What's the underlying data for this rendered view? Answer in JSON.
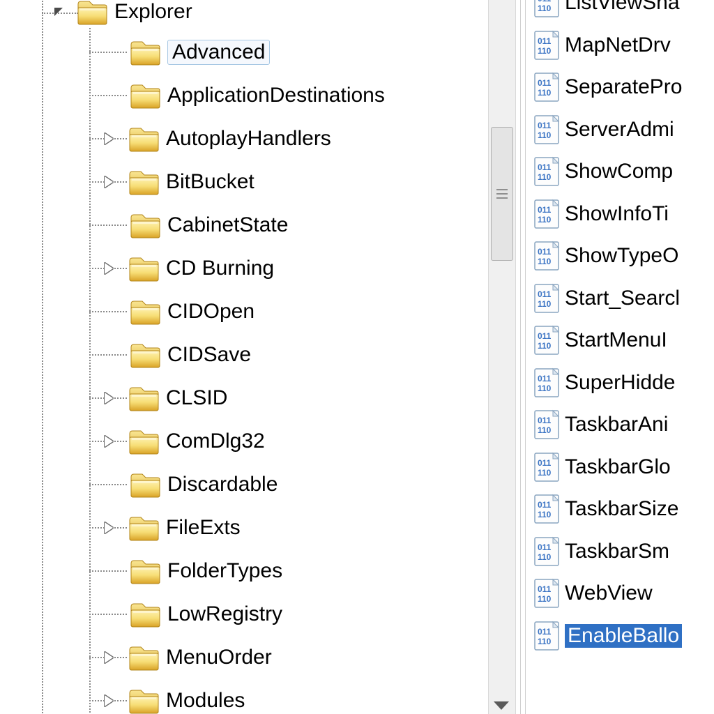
{
  "tree": {
    "root_label": "Explorer",
    "children": [
      {
        "label": "Advanced",
        "expander": "none",
        "selected": true
      },
      {
        "label": "ApplicationDestinations",
        "expander": "none"
      },
      {
        "label": "AutoplayHandlers",
        "expander": "closed"
      },
      {
        "label": "BitBucket",
        "expander": "closed"
      },
      {
        "label": "CabinetState",
        "expander": "none"
      },
      {
        "label": "CD Burning",
        "expander": "closed"
      },
      {
        "label": "CIDOpen",
        "expander": "none"
      },
      {
        "label": "CIDSave",
        "expander": "none"
      },
      {
        "label": "CLSID",
        "expander": "closed"
      },
      {
        "label": "ComDlg32",
        "expander": "closed"
      },
      {
        "label": "Discardable",
        "expander": "none"
      },
      {
        "label": "FileExts",
        "expander": "closed"
      },
      {
        "label": "FolderTypes",
        "expander": "none"
      },
      {
        "label": "LowRegistry",
        "expander": "none"
      },
      {
        "label": "MenuOrder",
        "expander": "closed"
      },
      {
        "label": "Modules",
        "expander": "closed"
      }
    ]
  },
  "values": [
    {
      "label": "ListViewSha"
    },
    {
      "label": "MapNetDrv"
    },
    {
      "label": "SeparatePro"
    },
    {
      "label": "ServerAdmi"
    },
    {
      "label": "ShowComp"
    },
    {
      "label": "ShowInfoTi"
    },
    {
      "label": "ShowTypeO"
    },
    {
      "label": "Start_Searcl"
    },
    {
      "label": "StartMenuI"
    },
    {
      "label": "SuperHidde"
    },
    {
      "label": "TaskbarAni"
    },
    {
      "label": "TaskbarGlo"
    },
    {
      "label": "TaskbarSize"
    },
    {
      "label": "TaskbarSm"
    },
    {
      "label": "WebView"
    },
    {
      "label": "EnableBallo",
      "selected": true
    }
  ]
}
